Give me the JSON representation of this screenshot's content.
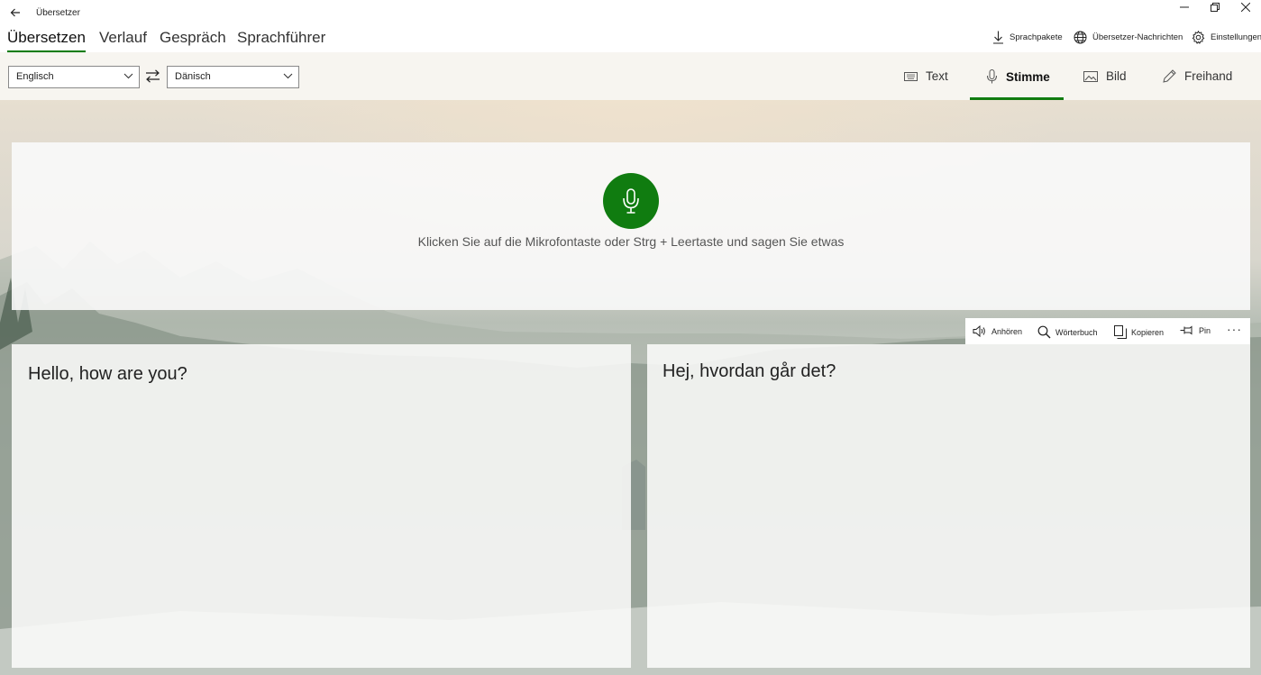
{
  "window": {
    "title": "Übersetzer"
  },
  "nav": {
    "tabs": [
      {
        "label": "Übersetzen",
        "active": true
      },
      {
        "label": "Verlauf"
      },
      {
        "label": "Gespräch"
      },
      {
        "label": "Sprachführer"
      }
    ],
    "actions": {
      "language_packs": "Sprachpakete",
      "news": "Übersetzer-Nachrichten",
      "settings": "Einstellungen"
    }
  },
  "languages": {
    "source": "Englisch",
    "target": "Dänisch"
  },
  "modes": [
    {
      "label": "Text",
      "icon": "keyboard-icon"
    },
    {
      "label": "Stimme",
      "icon": "microphone-icon",
      "active": true
    },
    {
      "label": "Bild",
      "icon": "image-icon"
    },
    {
      "label": "Freihand",
      "icon": "pen-icon"
    }
  ],
  "voice": {
    "hint": "Klicken Sie auf die Mikrofontaste oder Strg + Leertaste und sagen Sie etwas"
  },
  "source_text": "Hello, how are you?",
  "target_text": "Hej, hvordan går det?",
  "result_actions": {
    "listen": "Anhören",
    "dictionary": "Wörterbuch",
    "copy": "Kopieren",
    "pin": "Pin",
    "more": "···"
  },
  "colors": {
    "accent": "#107c10"
  }
}
